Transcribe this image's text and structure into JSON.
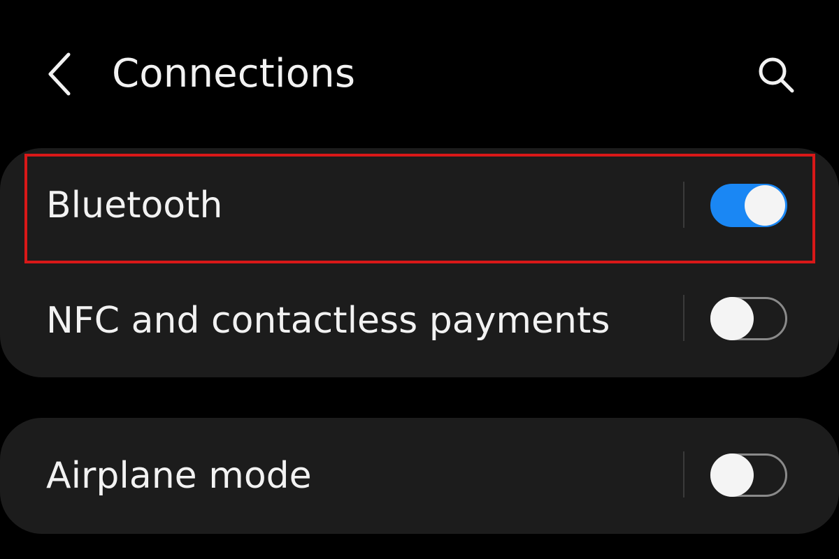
{
  "header": {
    "title": "Connections",
    "back_icon": "chevron-left-icon",
    "search_icon": "search-icon"
  },
  "settings": [
    {
      "label": "Bluetooth",
      "enabled": true
    },
    {
      "label": "NFC and contactless payments",
      "enabled": false
    },
    {
      "label": "Airplane mode",
      "enabled": false
    }
  ],
  "colors": {
    "background": "#000000",
    "card": "#1c1c1c",
    "toggle_on": "#1a87f4",
    "toggle_off_border": "#8a8a8a",
    "highlight": "#d81818"
  }
}
